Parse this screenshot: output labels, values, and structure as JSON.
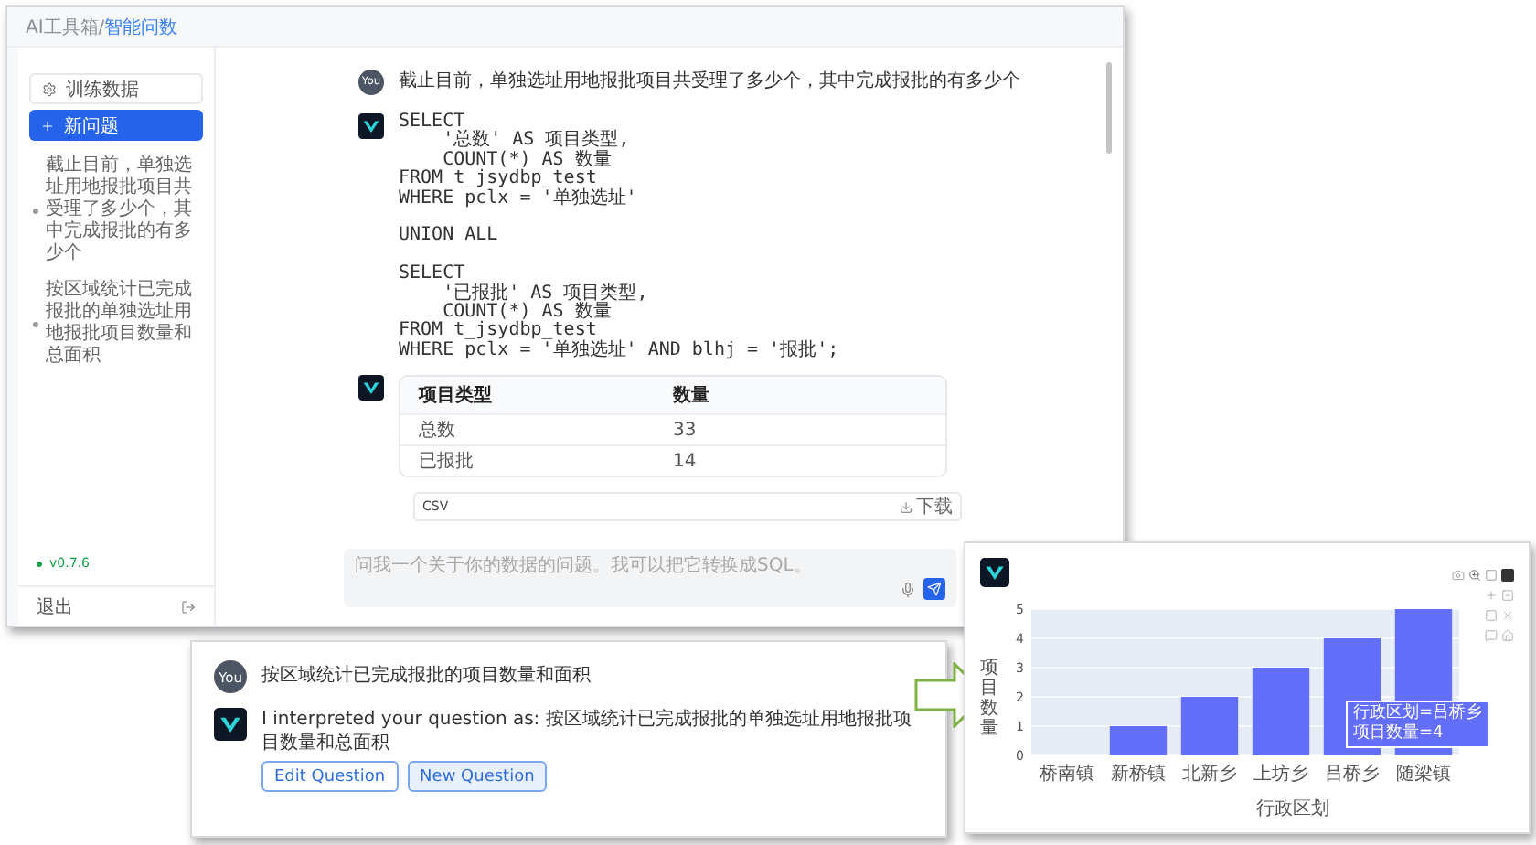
{
  "main_window": {
    "breadcrumb": [
      {
        "label": "AI工具箱/",
        "selected": false
      },
      {
        "label": "智能问数",
        "selected": true
      }
    ],
    "sidebar": {
      "training_button": "训练数据",
      "new_button": "新问题",
      "history": [
        {
          "text": "截止目前，单独选址用地报批项目共受理了多少个，其中完成报批的有多少个"
        },
        {
          "text": "按区域统计已完成报批的单独选址用地报批项目数量和总面积"
        }
      ],
      "version": "v0.7.6",
      "logout": "退出"
    },
    "chat": {
      "question": {
        "avatar": "You",
        "text": "截止目前，单独选址用地报批项目共受理了多少个，其中完成报批的有多少个"
      },
      "sql": "SELECT\n    '总数' AS 项目类型,\n    COUNT(*) AS 数量\nFROM t_jsydbp_test\nWHERE pclx = '单独选址'\n\nUNION ALL\n\nSELECT\n    '已报批' AS 项目类型,\n    COUNT(*) AS 数量\nFROM t_jsydbp_test\nWHERE pclx = '单独选址' AND blhj = '报批';",
      "table": {
        "columns": [
          "项目类型",
          "数量"
        ],
        "rows": [
          [
            "总数",
            "33"
          ],
          [
            "已报批",
            "14"
          ]
        ]
      },
      "csv": {
        "label": "CSV",
        "download": "下载"
      },
      "input": {
        "placeholder": "问我一个关于你的数据的问题。我可以把它转换成SQL。"
      }
    }
  },
  "followup_panel": {
    "question": {
      "avatar": "You",
      "text": "按区域统计已完成报批的项目数量和面积"
    },
    "answer": {
      "prefix": "I interpreted your question as:",
      "text": "按区域统计已完成报批的单独选址用地报批项目数量和总面积"
    },
    "buttons": [
      {
        "label": "Edit Question",
        "selected": false
      },
      {
        "label": "New Question",
        "selected": true
      }
    ]
  },
  "chart_panel": {
    "chart_data": {
      "type": "bar",
      "xlabel": "行政区划",
      "ylabel": "项目数量",
      "categories": [
        "桥南镇",
        "新桥镇",
        "北新乡",
        "上坊乡",
        "吕桥乡",
        "随梁镇"
      ],
      "series": [
        {
          "color": "#636efa",
          "values": [
            0,
            1,
            2,
            3,
            4,
            5
          ]
        }
      ],
      "grid": true,
      "ylim": [
        0,
        5
      ],
      "yticks": [
        0,
        1,
        2,
        3,
        4,
        5
      ]
    },
    "tooltip": [
      "行政区划=吕桥乡",
      "项目数量=4"
    ]
  }
}
